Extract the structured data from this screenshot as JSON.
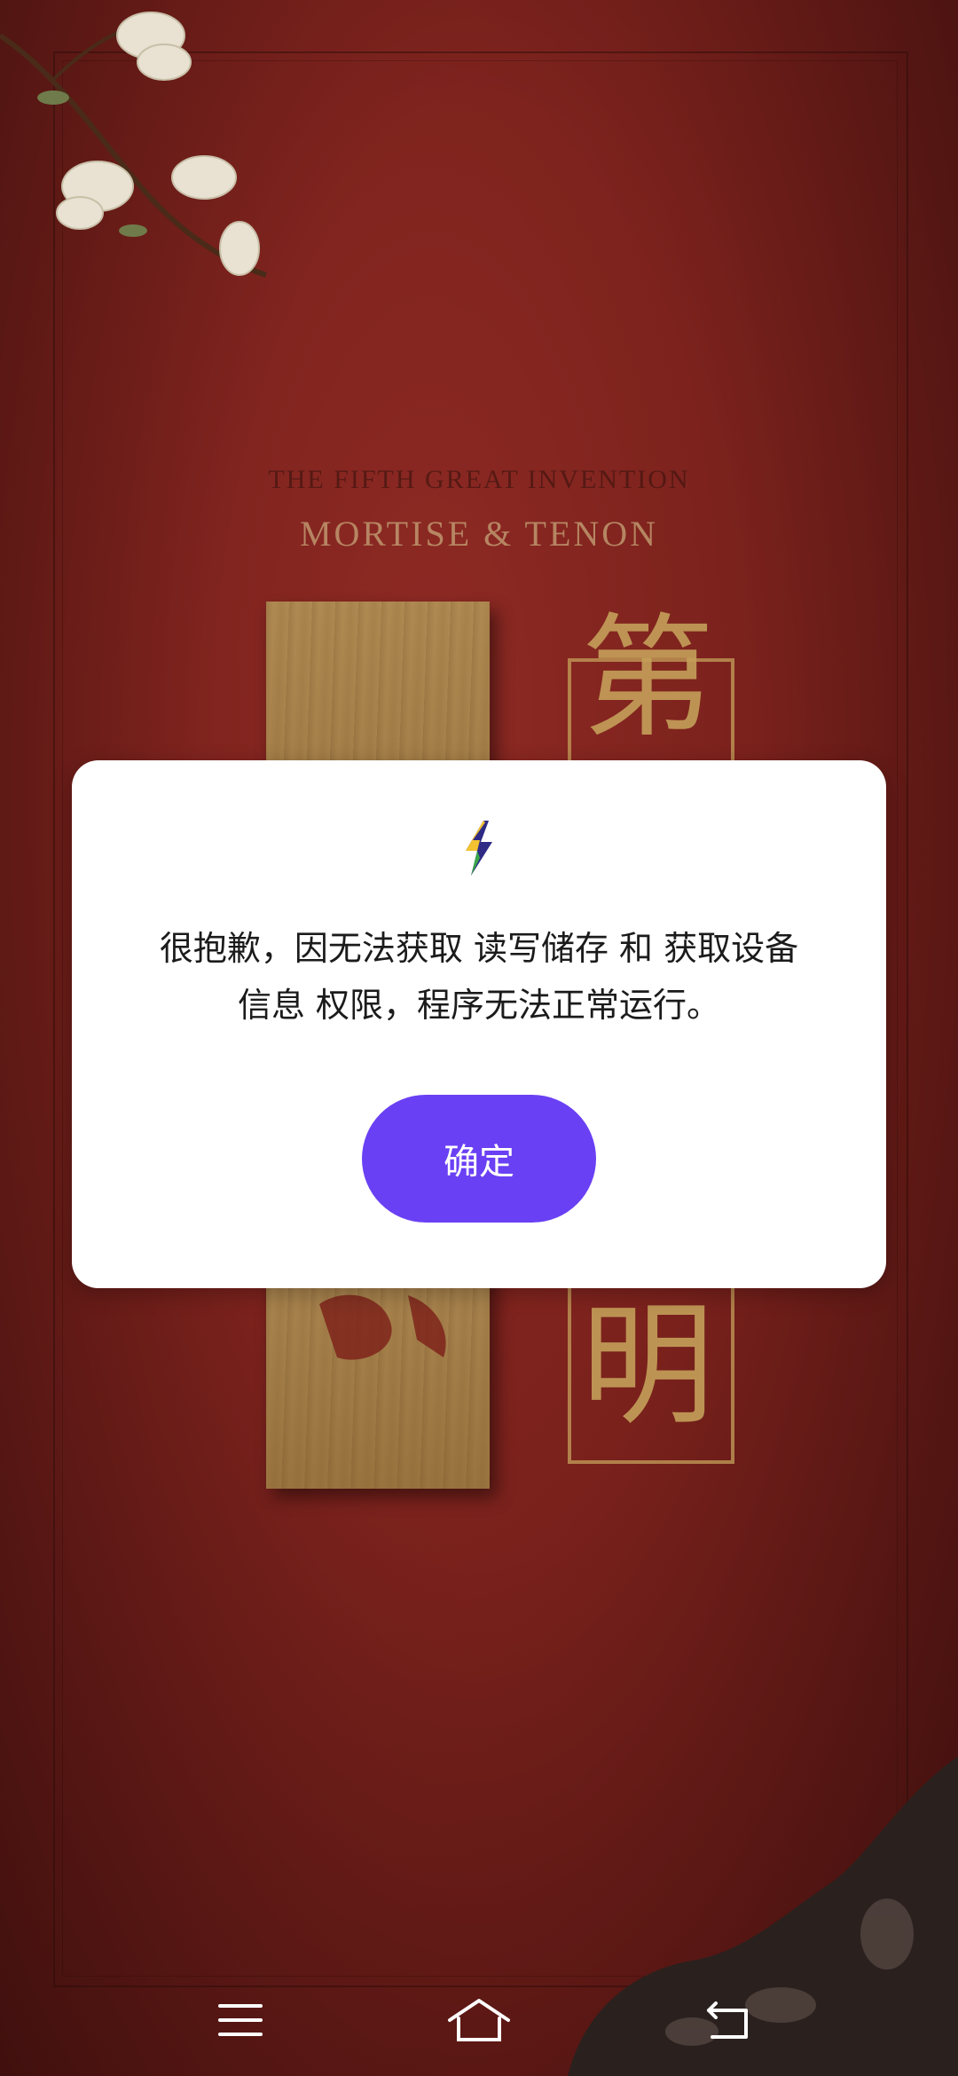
{
  "background": {
    "subtitle": "THE FIFTH GREAT INVENTION",
    "title": "MORTISE & TENON",
    "char_top": "第",
    "char_bottom": "明"
  },
  "dialog": {
    "icon": "lightning-bolt-icon",
    "message_line1": "很抱歉，因无法获取 读写储存 和 获取设备",
    "message_line2": "信息 权限，程序无法正常运行。",
    "confirm_label": "确定"
  },
  "navbar": {
    "menu_icon": "menu-icon",
    "home_icon": "home-icon",
    "back_icon": "back-icon"
  },
  "colors": {
    "accent": "#6a40f4",
    "background": "#7a211c"
  }
}
